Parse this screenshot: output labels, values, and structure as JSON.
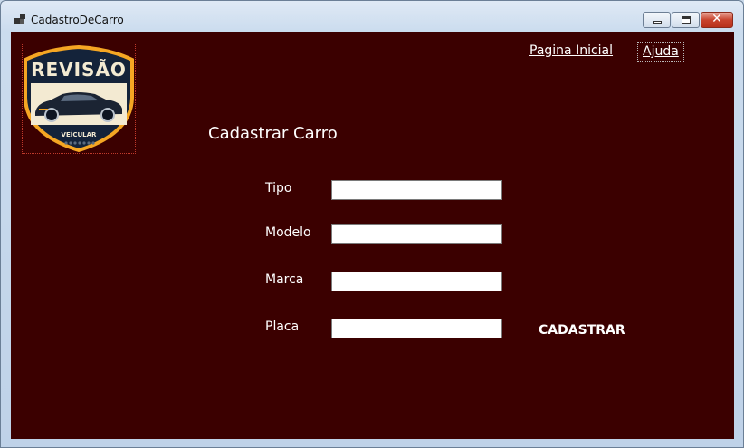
{
  "window": {
    "title": "CadastroDeCarro",
    "close_glyph": "✕"
  },
  "logo": {
    "text_top": "REVISÃO",
    "text_bottom": "VEÍCULAR"
  },
  "nav": {
    "home": "Pagina Inicial",
    "help": "Ajuda"
  },
  "form": {
    "heading": "Cadastrar Carro",
    "fields": [
      {
        "label": "Tipo",
        "value": ""
      },
      {
        "label": "Modelo",
        "value": ""
      },
      {
        "label": "Marca",
        "value": ""
      },
      {
        "label": "Placa",
        "value": ""
      }
    ],
    "submit_label": "CADASTRAR"
  },
  "colors": {
    "background": "#3b0000",
    "text": "#ffffff",
    "logo_border": "#f5a623",
    "logo_dark": "#14233a",
    "logo_cream": "#f3ead2"
  }
}
